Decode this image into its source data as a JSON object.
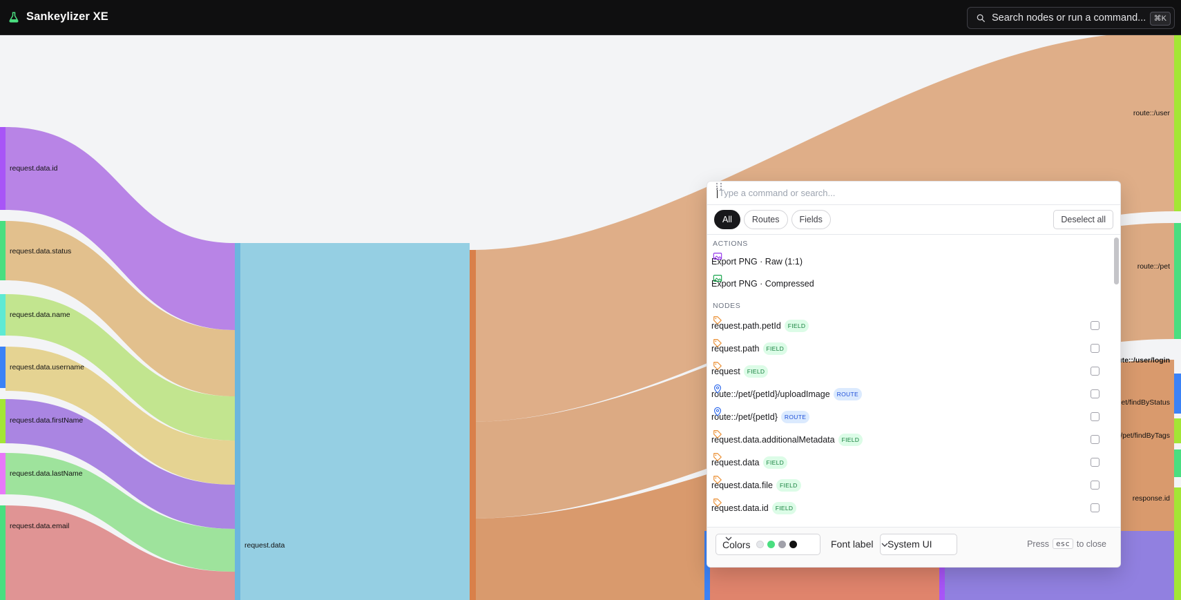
{
  "app": {
    "title": "Sankeylizer XE",
    "logo_icon": "flask-icon"
  },
  "search": {
    "placeholder": "Search nodes or run a command...",
    "shortcut": "⌘K"
  },
  "sankey": {
    "left_nodes": [
      {
        "label": "request.data.id",
        "color": "#a855f7"
      },
      {
        "label": "request.data.status",
        "color": "#4ade80"
      },
      {
        "label": "request.data.name",
        "color": "#5eead4"
      },
      {
        "label": "request.data.username",
        "color": "#3b82f6"
      },
      {
        "label": "request.data.firstName",
        "color": "#a3e635"
      },
      {
        "label": "request.data.lastName",
        "color": "#e879f9"
      },
      {
        "label": "request.data.email",
        "color": "#4ade80"
      }
    ],
    "middle_node": {
      "label": "request.data",
      "color": "#60a5fa"
    },
    "right_nodes": [
      {
        "label": "route::/user",
        "color": "#a3e635"
      },
      {
        "label": "route::/pet",
        "color": "#4ade80"
      },
      {
        "label": "route::/user/login",
        "color": "#3b82f6"
      },
      {
        "label": "route::/pet/findByStatus",
        "color": "#a3e635"
      },
      {
        "label": "route::/pet/findByTags",
        "color": "#4ade80"
      },
      {
        "label": "response.id",
        "color": "#a3e635"
      }
    ]
  },
  "palette": {
    "input_placeholder": "Type a command or search...",
    "filters": [
      "All",
      "Routes",
      "Fields"
    ],
    "active_filter": "All",
    "deselect_label": "Deselect all",
    "actions_heading": "ACTIONS",
    "actions": [
      {
        "label": "Export PNG · Raw (1:1)",
        "icon": "image-icon",
        "color": "#9333ea"
      },
      {
        "label": "Export PNG · Compressed",
        "icon": "image-icon",
        "color": "#16a34a"
      }
    ],
    "nodes_heading": "NODES",
    "nodes": [
      {
        "label": "request.path.petId",
        "type": "FIELD",
        "icon": "tag-icon",
        "checked": false
      },
      {
        "label": "request.path",
        "type": "FIELD",
        "icon": "tag-icon",
        "checked": false
      },
      {
        "label": "request",
        "type": "FIELD",
        "icon": "tag-icon",
        "checked": false
      },
      {
        "label": "route::/pet/{petId}/uploadImage",
        "type": "ROUTE",
        "icon": "map-pin-icon",
        "checked": false
      },
      {
        "label": "route::/pet/{petId}",
        "type": "ROUTE",
        "icon": "map-pin-icon",
        "checked": false
      },
      {
        "label": "request.data.additionalMetadata",
        "type": "FIELD",
        "icon": "tag-icon",
        "checked": false
      },
      {
        "label": "request.data",
        "type": "FIELD",
        "icon": "tag-icon",
        "checked": false
      },
      {
        "label": "request.data.file",
        "type": "FIELD",
        "icon": "tag-icon",
        "checked": false
      },
      {
        "label": "request.data.id",
        "type": "FIELD",
        "icon": "tag-icon",
        "checked": false
      }
    ],
    "footer": {
      "colors_label": "Colors",
      "swatches": [
        "#e5e7eb",
        "#4ade80",
        "#a1a1aa",
        "#111111"
      ],
      "font_label": "Font label",
      "font_value": "System UI",
      "press": "Press",
      "esc": "esc",
      "to_close": "to close"
    }
  }
}
